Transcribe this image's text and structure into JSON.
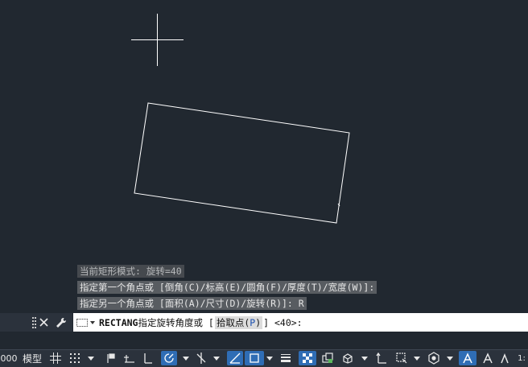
{
  "history": {
    "line1": "当前矩形模式:  旋转=40",
    "line2": "指定第一个角点或 [倒角(C)/标高(E)/圆角(F)/厚度(T)/宽度(W)]:",
    "line3": "指定另一个角点或 [面积(A)/尺寸(D)/旋转(R)]: R"
  },
  "command_line": {
    "command": "RECTANG",
    "prompt": " 指定旋转角度或 [",
    "option_label": "拾取点",
    "option_key_open": "(",
    "option_key": "P",
    "option_key_close": ")",
    "suffix": "] <40>:"
  },
  "statusbar": {
    "coord_fragment": "000",
    "model_tab": "模型"
  },
  "colors": {
    "background": "#212830",
    "geometry": "#ffffff",
    "active_button": "#2f6db5"
  },
  "icons": {
    "close": "close-icon",
    "customize": "wrench-icon",
    "grip": "grip-icon"
  }
}
